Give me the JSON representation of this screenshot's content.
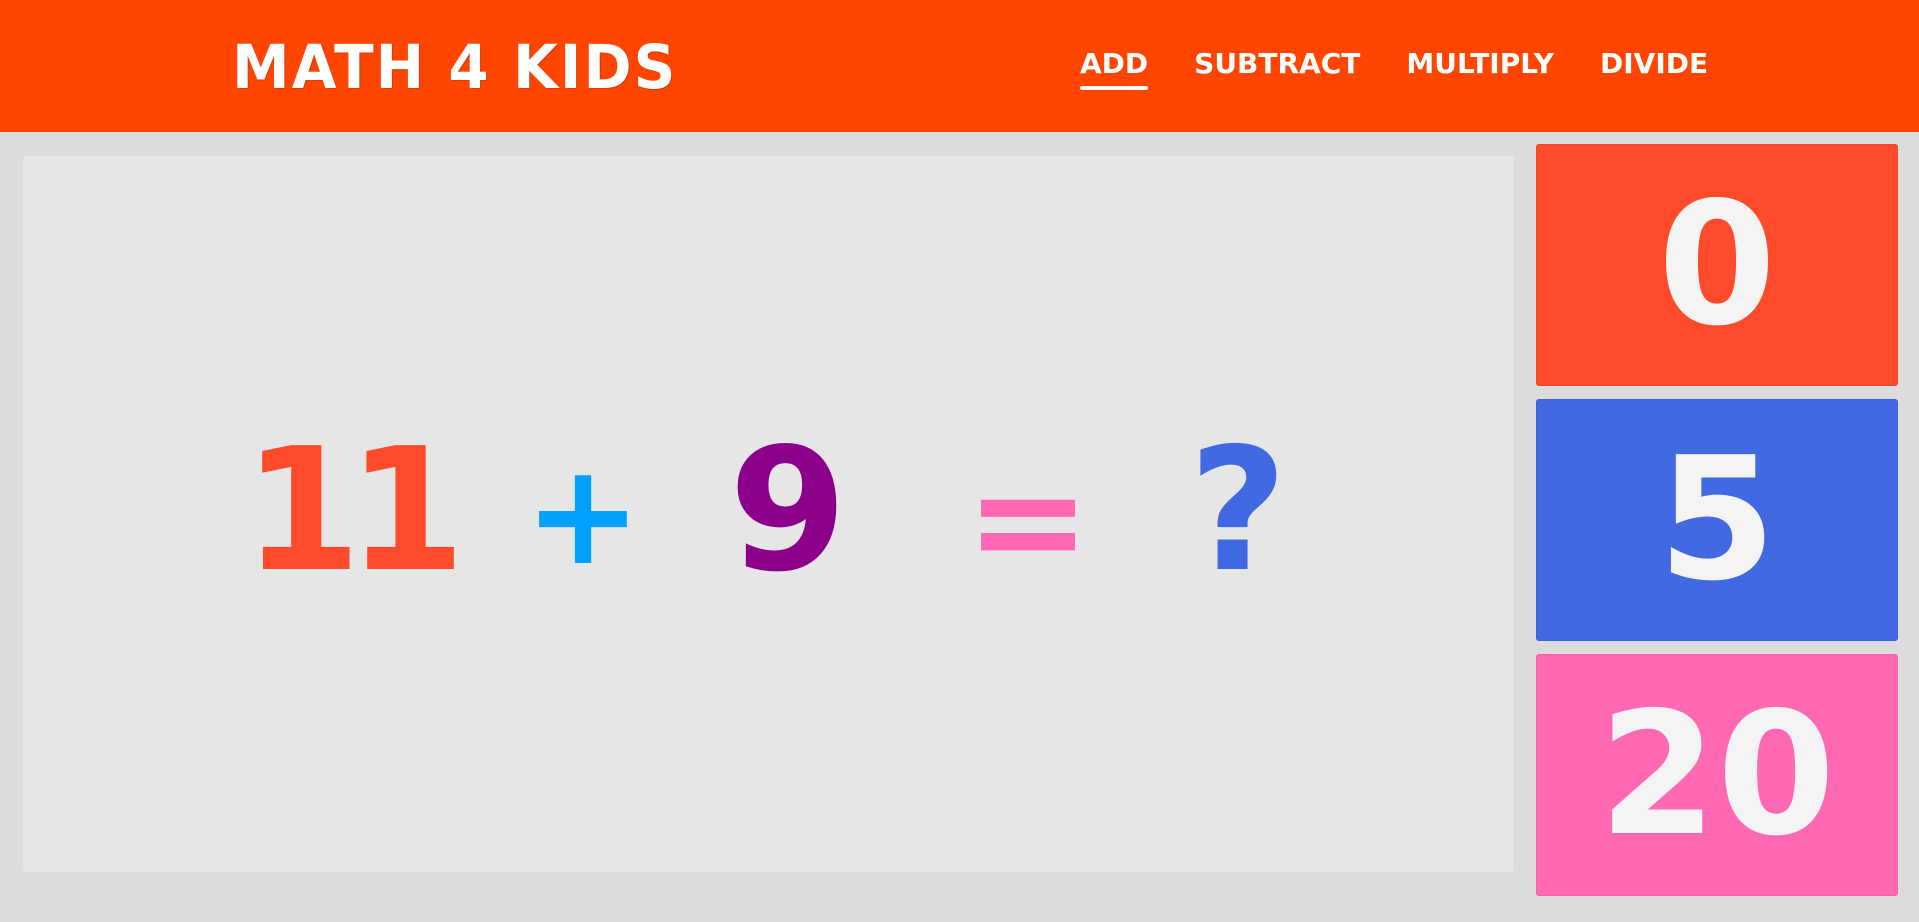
{
  "header": {
    "logo": "MATH 4 KIDS",
    "background": "#ff4500",
    "nav": [
      {
        "label": "ADD",
        "active": true
      },
      {
        "label": "SUBTRACT",
        "active": false
      },
      {
        "label": "MULTIPLY",
        "active": false
      },
      {
        "label": "DIVIDE",
        "active": false
      }
    ]
  },
  "problem": {
    "operand_a": "11",
    "operator": "+",
    "operand_b": "9",
    "equals": "=",
    "unknown": "?",
    "colors": {
      "operand_a": "#ff4b2b",
      "operator": "#00a0ff",
      "operand_b": "#8b008b",
      "equals": "#ff69b4",
      "unknown": "#4169e1"
    }
  },
  "answers": [
    {
      "label": "0",
      "color": "#ff4b2b"
    },
    {
      "label": "5",
      "color": "#4169e1"
    },
    {
      "label": "20",
      "color": "#ff69b4"
    }
  ]
}
